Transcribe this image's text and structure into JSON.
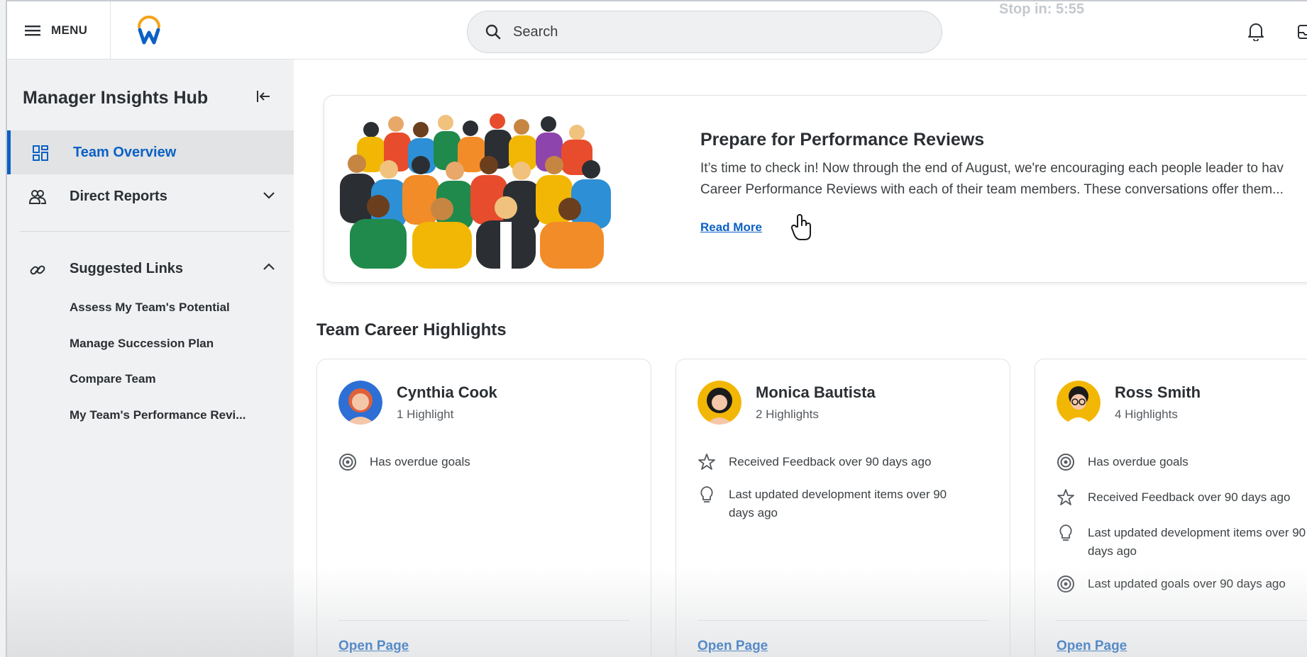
{
  "header": {
    "menu_label": "MENU",
    "search_placeholder": "Search",
    "recording_text": "Stop in: 5:55"
  },
  "sidebar": {
    "title": "Manager Insights Hub",
    "items": [
      {
        "label": "Team Overview",
        "icon": "dashboard-icon",
        "active": true
      },
      {
        "label": "Direct Reports",
        "icon": "people-icon",
        "expanded": false
      }
    ],
    "suggested": {
      "label": "Suggested Links",
      "icon": "link-icon",
      "expanded": true,
      "links": [
        "Assess My Team's Potential",
        "Manage Succession Plan",
        "Compare Team",
        "My Team's Performance Revi..."
      ]
    }
  },
  "banner": {
    "title": "Prepare for Performance Reviews",
    "body_line1": "It’s time to check in! Now through the end of August, we're encouraging each people leader to hav",
    "body_line2": "Career Performance Reviews with each of their team members. These conversations offer them...",
    "link": "Read More"
  },
  "highlights": {
    "title": "Team Career Highlights",
    "cards": [
      {
        "name": "Cynthia Cook",
        "count": "1 Highlight",
        "items": [
          {
            "icon": "target-icon",
            "text": "Has overdue goals"
          }
        ],
        "link": "Open Page"
      },
      {
        "name": "Monica Bautista",
        "count": "2 Highlights",
        "items": [
          {
            "icon": "star-icon",
            "text": "Received Feedback over 90 days ago"
          },
          {
            "icon": "lightbulb-icon",
            "text": "Last updated development items over 90 days ago"
          }
        ],
        "link": "Open Page"
      },
      {
        "name": "Ross Smith",
        "count": "4 Highlights",
        "items": [
          {
            "icon": "target-icon",
            "text": "Has overdue goals"
          },
          {
            "icon": "star-icon",
            "text": "Received Feedback over 90 days ago"
          },
          {
            "icon": "lightbulb-icon",
            "text": "Last updated development items over 90 days ago"
          },
          {
            "icon": "target-icon",
            "text": "Last updated goals over 90 days ago"
          }
        ],
        "link": "Open Page"
      }
    ]
  },
  "colors": {
    "accent": "#0b60c4",
    "text": "#2b2f33",
    "sidebar_bg": "#f0f1f2"
  }
}
